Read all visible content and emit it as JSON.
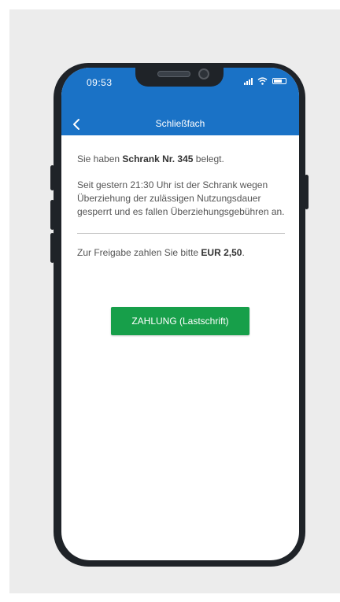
{
  "status_bar": {
    "time": "09:53",
    "signal_icon": "signal-bars-icon",
    "wifi_icon": "wifi-icon",
    "battery_icon": "battery-icon",
    "battery_level": 0.85
  },
  "nav": {
    "back_icon": "chevron-left-icon",
    "title": "Schließfach",
    "bg_color": "#1a72c6"
  },
  "content": {
    "line1_pre": "Sie haben ",
    "line1_bold": "Schrank Nr. 345",
    "line1_post": " belegt.",
    "paragraph2": "Seit gestern 21:30 Uhr ist der Schrank wegen Überziehung der zulässigen Nutzungsdauer gesperrt und es fallen Überziehungsgebühren an.",
    "payment_pre": "Zur Freigabe zahlen Sie bitte ",
    "payment_bold": "EUR 2,50",
    "payment_post": "."
  },
  "pay_button": {
    "label": "ZAHLUNG (Lastschrift)",
    "color": "#179f4a"
  }
}
